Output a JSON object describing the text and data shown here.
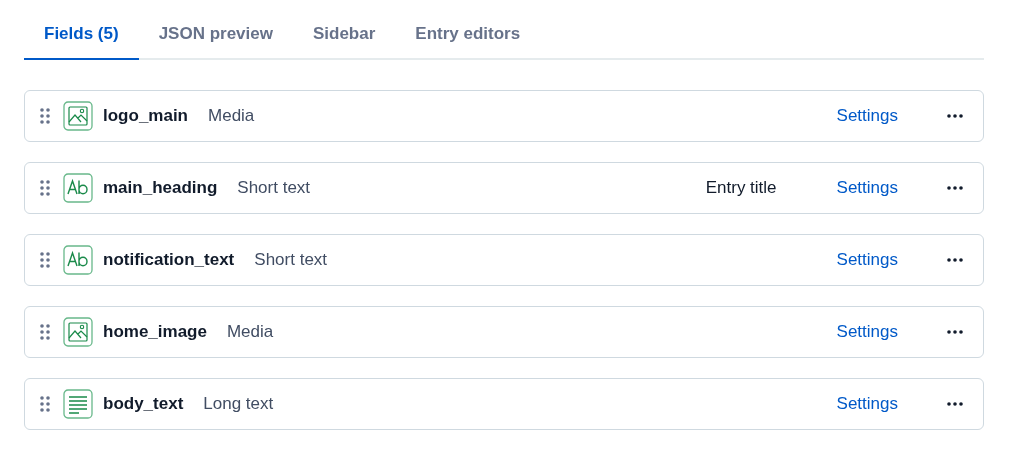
{
  "tabs": [
    {
      "label": "Fields (5)",
      "selected": true
    },
    {
      "label": "JSON preview",
      "selected": false
    },
    {
      "label": "Sidebar",
      "selected": false
    },
    {
      "label": "Entry editors",
      "selected": false
    }
  ],
  "fields": [
    {
      "name": "logo_main",
      "type": "Media",
      "kind": "media",
      "settings": "Settings"
    },
    {
      "name": "main_heading",
      "type": "Short text",
      "kind": "short",
      "entry_title": "Entry title",
      "settings": "Settings"
    },
    {
      "name": "notification_text",
      "type": "Short text",
      "kind": "short",
      "settings": "Settings"
    },
    {
      "name": "home_image",
      "type": "Media",
      "kind": "media",
      "settings": "Settings"
    },
    {
      "name": "body_text",
      "type": "Long text",
      "kind": "long",
      "settings": "Settings"
    }
  ]
}
